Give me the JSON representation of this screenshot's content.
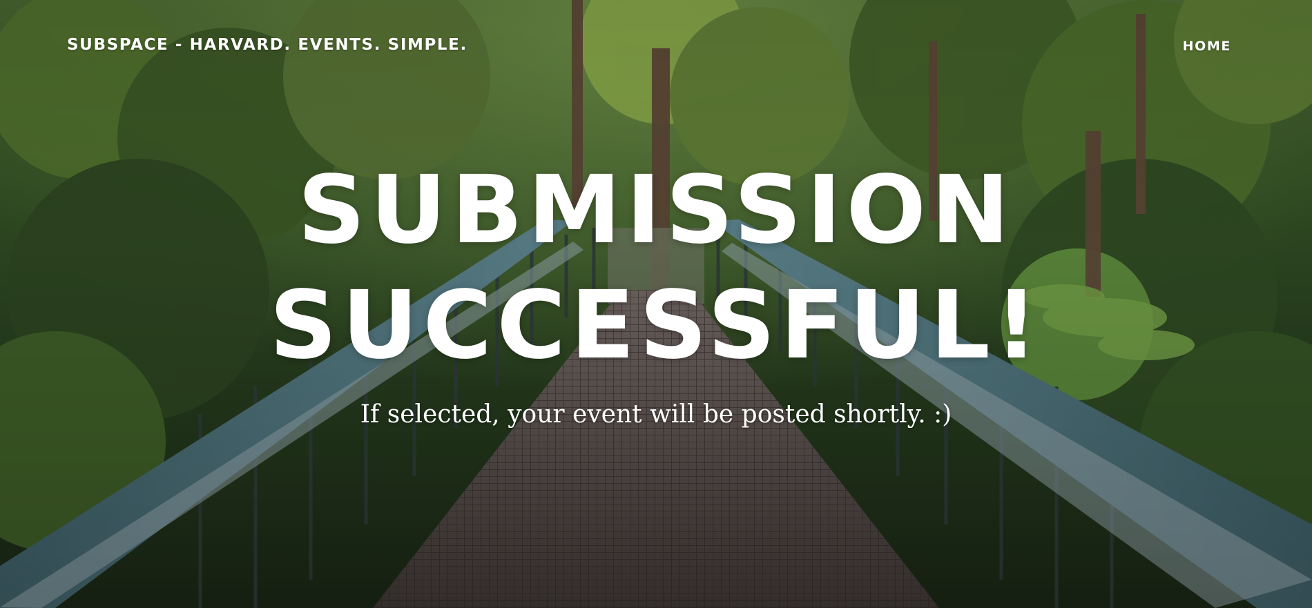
{
  "header": {
    "site_title": "SUBSPACE - HARVARD. EVENTS. SIMPLE.",
    "nav": {
      "home_label": "HOME"
    }
  },
  "hero": {
    "title": "SUBMISSION SUCCESSFUL!",
    "subtitle": "If selected, your event will be posted shortly. :)"
  },
  "colors": {
    "text": "#ffffff",
    "forest_dark": "#1c2a1a",
    "bridge_railing": "#466b74",
    "walkway": "#5a5250"
  }
}
